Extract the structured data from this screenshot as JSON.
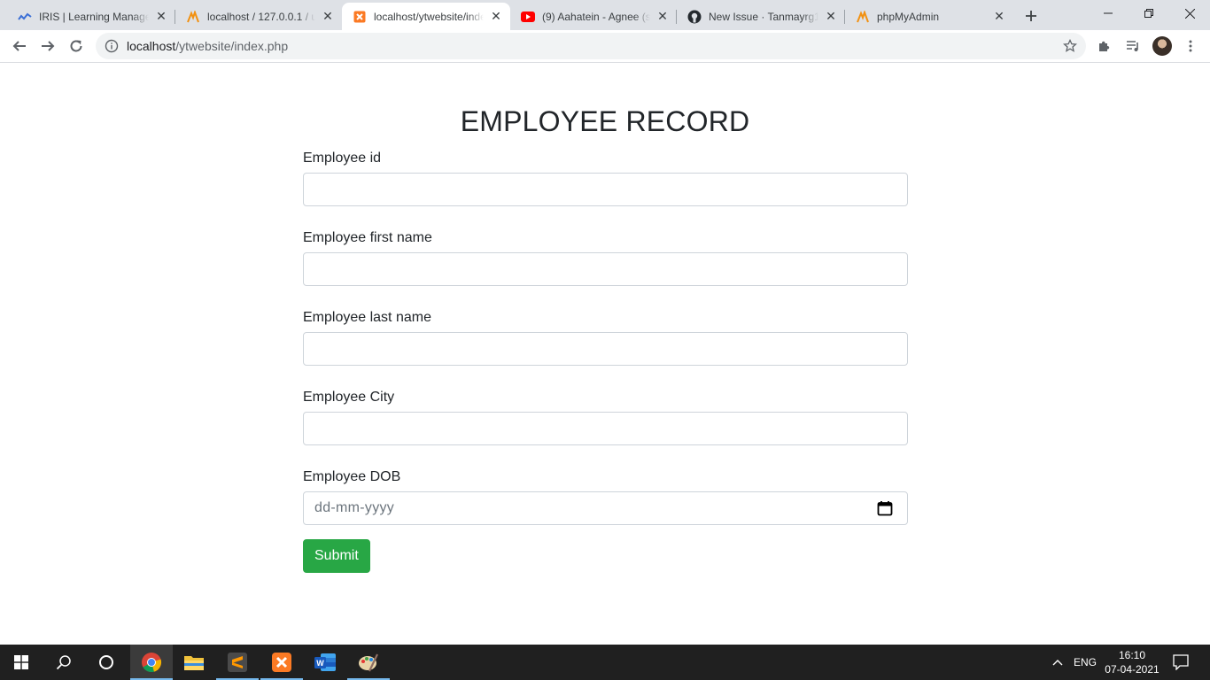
{
  "browser": {
    "tabs": [
      {
        "title": "IRIS | Learning Management",
        "icon": "iris-wave-icon"
      },
      {
        "title": "localhost / 127.0.0.1 / ut",
        "icon": "phpmyadmin-icon"
      },
      {
        "title": "localhost/ytwebsite/index.php",
        "icon": "xampp-icon"
      },
      {
        "title": "(9) Aahatein - Agnee (sp",
        "icon": "youtube-icon"
      },
      {
        "title": "New Issue · Tanmayrg15",
        "icon": "github-icon"
      },
      {
        "title": "phpMyAdmin",
        "icon": "phpmyadmin-icon"
      }
    ],
    "active_tab": 2,
    "url_host": "localhost",
    "url_path": "/ytwebsite/index.php"
  },
  "page": {
    "title": "EMPLOYEE RECORD",
    "fields": [
      {
        "label": "Employee id",
        "value": ""
      },
      {
        "label": "Employee first name",
        "value": ""
      },
      {
        "label": "Employee last name",
        "value": ""
      },
      {
        "label": "Employee City",
        "value": ""
      }
    ],
    "dob": {
      "label": "Employee DOB",
      "placeholder": "dd-mm-yyyy"
    },
    "submit_label": "Submit"
  },
  "taskbar": {
    "apps": [
      "start-icon",
      "search-icon",
      "cortana-icon",
      "chrome-icon",
      "file-explorer-icon",
      "sublime-text-icon",
      "xampp-icon",
      "word-icon",
      "paint-icon"
    ],
    "language": "ENG",
    "time": "16:10",
    "date": "07-04-2021"
  },
  "colors": {
    "submit": "#28a745",
    "tabstrip": "#dee1e6",
    "taskbar": "#202020"
  }
}
